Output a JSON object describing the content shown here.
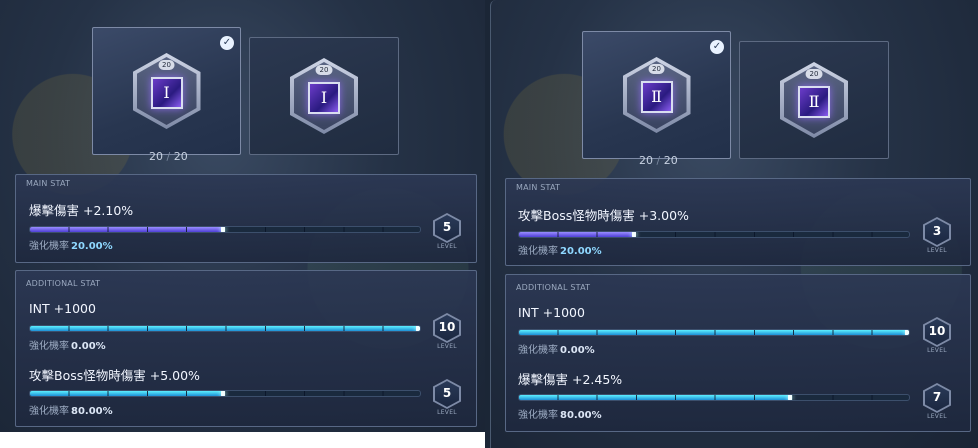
{
  "panels": [
    {
      "slots": [
        {
          "level": "20",
          "symbol": "Ⅰ",
          "selected": true
        },
        {
          "level": "20",
          "symbol": "Ⅰ",
          "selected": false
        }
      ],
      "count": {
        "current": "20",
        "sep": "/",
        "max": "20"
      },
      "main": {
        "title": "MAIN STAT",
        "stat": "爆擊傷害 +2.10%",
        "rate_label": "強化機率",
        "rate_value": "20.00%",
        "progress": 0.5,
        "level": "5",
        "level_word": "LEVEL"
      },
      "additional": {
        "title": "ADDITIONAL STAT",
        "rows": [
          {
            "stat": "INT +1000",
            "rate_label": "強化機率",
            "rate_value": "0.00%",
            "progress": 1.0,
            "level": "10",
            "level_word": "LEVEL"
          },
          {
            "stat": "攻擊Boss怪物時傷害 +5.00%",
            "rate_label": "強化機率",
            "rate_value": "80.00%",
            "progress": 0.5,
            "level": "5",
            "level_word": "LEVEL"
          }
        ]
      }
    },
    {
      "slots": [
        {
          "level": "20",
          "symbol": "Ⅱ",
          "selected": true
        },
        {
          "level": "20",
          "symbol": "Ⅱ",
          "selected": false
        }
      ],
      "count": {
        "current": "20",
        "sep": "/",
        "max": "20"
      },
      "main": {
        "title": "MAIN STAT",
        "stat": "攻擊Boss怪物時傷害 +3.00%",
        "rate_label": "強化機率",
        "rate_value": "20.00%",
        "progress": 0.3,
        "level": "3",
        "level_word": "LEVEL"
      },
      "additional": {
        "title": "ADDITIONAL STAT",
        "rows": [
          {
            "stat": "INT +1000",
            "rate_label": "強化機率",
            "rate_value": "0.00%",
            "progress": 1.0,
            "level": "10",
            "level_word": "LEVEL"
          },
          {
            "stat": "爆擊傷害 +2.45%",
            "rate_label": "強化機率",
            "rate_value": "80.00%",
            "progress": 0.7,
            "level": "7",
            "level_word": "LEVEL"
          }
        ]
      }
    }
  ],
  "colors": {
    "main_bar": "#6a5cf0",
    "additional_bar": "#36c8f0",
    "check_icon": "#e9f2ff"
  }
}
